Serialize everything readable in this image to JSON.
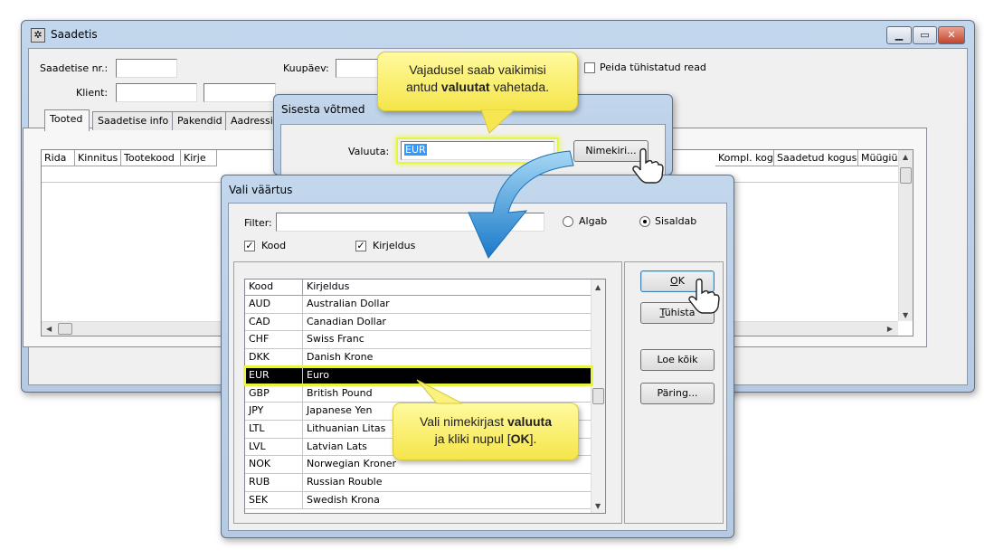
{
  "main": {
    "title": "Saadetis",
    "fields": {
      "saadetise_nr_label": "Saadetise nr.:",
      "kuupaev_label": "Kuupäev:",
      "klient_label": "Klient:",
      "peida_label": "Peida tühistatud read"
    },
    "tabs": [
      {
        "label": "Tooted"
      },
      {
        "label": "Saadetise info"
      },
      {
        "label": "Pakendid"
      },
      {
        "label": "Aadressi"
      }
    ],
    "grid_columns_left": [
      "Rida",
      "Kinnitus",
      "Tootekood",
      "Kirje"
    ],
    "grid_columns_right": [
      "Kompl. kogu",
      "Saadetud kogus",
      "Müügiühik"
    ]
  },
  "keys_dialog": {
    "title": "Sisesta võtmed",
    "valuuta_label": "Valuuta:",
    "valuuta_value": "EUR",
    "list_button": "Nimekiri..."
  },
  "value_dialog": {
    "title": "Vali väärtus",
    "filter_label": "Filter:",
    "filter_value": "",
    "algab_label": "Algab",
    "sisaldab_label": "Sisaldab",
    "kood_check_label": "Kood",
    "kirjeldus_check_label": "Kirjeldus",
    "columns": {
      "kood": "Kood",
      "kirjeldus": "Kirjeldus"
    },
    "rows": [
      {
        "code": "AUD",
        "desc": "Australian Dollar"
      },
      {
        "code": "CAD",
        "desc": "Canadian Dollar"
      },
      {
        "code": "CHF",
        "desc": "Swiss Franc"
      },
      {
        "code": "DKK",
        "desc": "Danish Krone"
      },
      {
        "code": "EUR",
        "desc": "Euro"
      },
      {
        "code": "GBP",
        "desc": "British Pound"
      },
      {
        "code": "JPY",
        "desc": "Japanese Yen"
      },
      {
        "code": "LTL",
        "desc": "Lithuanian Litas"
      },
      {
        "code": "LVL",
        "desc": "Latvian Lats"
      },
      {
        "code": "NOK",
        "desc": "Norwegian Kroner"
      },
      {
        "code": "RUB",
        "desc": "Russian Rouble"
      },
      {
        "code": "SEK",
        "desc": "Swedish Krona"
      }
    ],
    "selected_code": "EUR",
    "buttons": {
      "ok_key": "O",
      "ok_rest": "K",
      "cancel_key": "T",
      "cancel_rest": "ühista",
      "load_all": "Loe kõik",
      "query": "Päring..."
    }
  },
  "callouts": {
    "top_line1": "Vajadusel saab vaikimisi",
    "top_line2_pre": "antud ",
    "top_line2_bold": "valuutat",
    "top_line2_post": " vahetada.",
    "bottom_line1_pre": "Vali nimekirjast ",
    "bottom_line1_bold": "valuuta",
    "bottom_line2_pre": "ja kliki nupul [",
    "bottom_line2_bold": "OK",
    "bottom_line2_post": "]."
  },
  "colors": {
    "highlight": "#e6f53d",
    "callout": "#f9ee6e",
    "arrow": "#2b8fd6",
    "selection": "#000000"
  }
}
